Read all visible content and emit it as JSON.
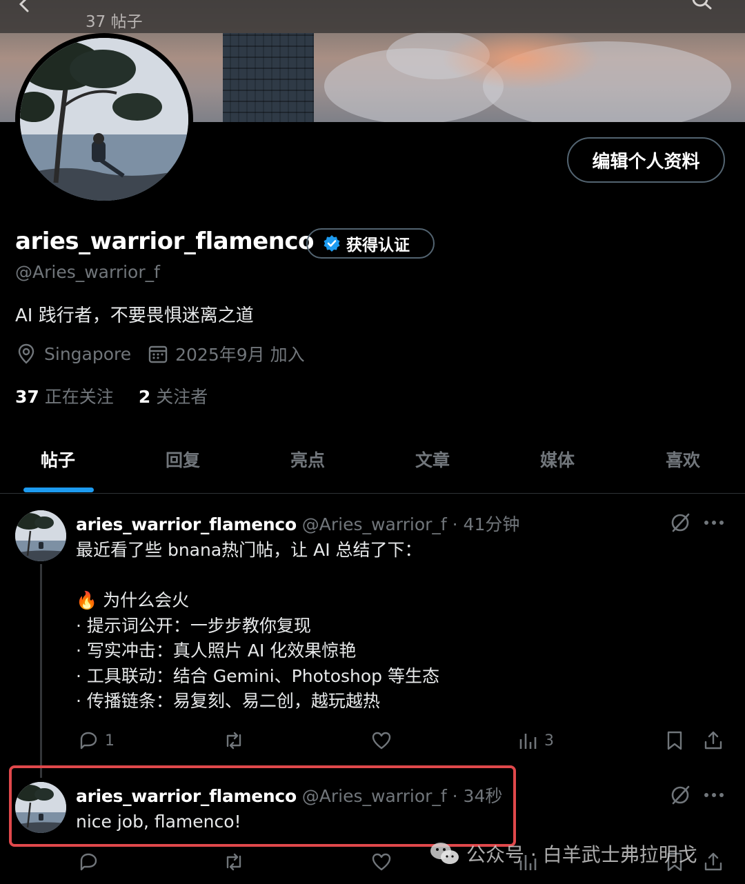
{
  "topbar": {
    "post_count": "37 帖子"
  },
  "profile": {
    "display_name": "aries_warrior_flamenco",
    "verified_label": "获得认证",
    "handle": "@Aries_warrior_f",
    "bio": "AI 践行者，不要畏惧迷离之道",
    "location": "Singapore",
    "joined": "2025年9月 加入",
    "following_count": "37",
    "following_label": "正在关注",
    "followers_count": "2",
    "followers_label": "关注者",
    "edit_button": "编辑个人资料"
  },
  "tabs": [
    "帖子",
    "回复",
    "亮点",
    "文章",
    "媒体",
    "喜欢"
  ],
  "posts": [
    {
      "name": "aries_warrior_flamenco",
      "meta": "@Aries_warrior_f · 41分钟",
      "lines": [
        "最近看了些 bnana热门帖，让 AI 总结了下：",
        "",
        "为什么会火",
        "· 提示词公开：一步步教你复现",
        "· 写实冲击：真人照片 AI 化效果惊艳",
        "· 工具联动：结合 Gemini、Photoshop 等生态",
        "· 传播链条：易复刻、易二创，越玩越热"
      ],
      "fire_emoji": "🔥",
      "reply_count": "1",
      "view_count": "3"
    },
    {
      "name": "aries_warrior_flamenco",
      "meta": "@Aries_warrior_f · 34秒",
      "lines": [
        "nice job, flamenco!"
      ]
    }
  ],
  "watermark": {
    "text": "公众号 · 白羊武士弗拉明戈"
  },
  "colors": {
    "accent": "#1d9bf0",
    "highlight": "#e0484b",
    "background": "#000000",
    "muted": "#71767b"
  }
}
